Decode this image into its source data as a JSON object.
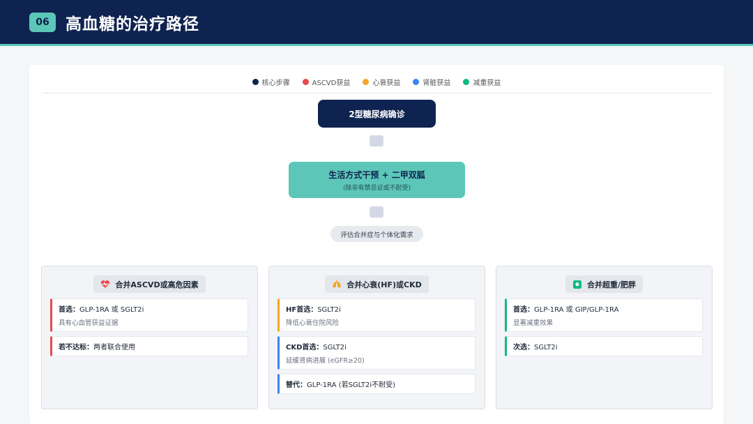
{
  "header": {
    "number": "06",
    "title": "高血糖的治疗路径"
  },
  "legend": [
    {
      "label": "核心步骤",
      "color": "#0f2350"
    },
    {
      "label": "ASCVD获益",
      "color": "#e5484d"
    },
    {
      "label": "心衰获益",
      "color": "#f5a524"
    },
    {
      "label": "肾脏获益",
      "color": "#3b82f6"
    },
    {
      "label": "减重获益",
      "color": "#10b981"
    }
  ],
  "flow": {
    "start": "2型糖尿病确诊",
    "step": {
      "title": "生活方式干预 + 二甲双胍",
      "subtitle": "(除非有禁忌证或不耐受)"
    },
    "assess": "评估合并症与个体化需求"
  },
  "columns": [
    {
      "title": "合并ASCVD或高危因素",
      "icon": "heart-pulse-icon",
      "cards": [
        {
          "label": "首选：",
          "text": "GLP-1RA 或 SGLT2i",
          "sub": "具有心血管获益证据",
          "color": "#e5484d"
        },
        {
          "label": "若不达标：",
          "text": "两者联合使用",
          "sub": "",
          "color": "#e5484d"
        }
      ]
    },
    {
      "title": "合并心衰(HF)或CKD",
      "icon": "lungs-icon",
      "cards": [
        {
          "label": "HF首选：",
          "text": "SGLT2i",
          "sub": "降低心衰住院风险",
          "color": "#f5a524"
        },
        {
          "label": "CKD首选：",
          "text": "SGLT2i",
          "sub": "延缓肾病进展 (eGFR≥20)",
          "color": "#3b82f6"
        },
        {
          "label": "替代：",
          "text": "GLP-1RA (若SGLT2i不耐受)",
          "sub": "",
          "color": "#3b82f6"
        }
      ]
    },
    {
      "title": "合并超重/肥胖",
      "icon": "scale-icon",
      "cards": [
        {
          "label": "首选：",
          "text": "GLP-1RA 或 GIP/GLP-1RA",
          "sub": "显著减重效果",
          "color": "#10b981"
        },
        {
          "label": "次选：",
          "text": "SGLT2i",
          "sub": "",
          "color": "#10b981"
        }
      ]
    }
  ]
}
